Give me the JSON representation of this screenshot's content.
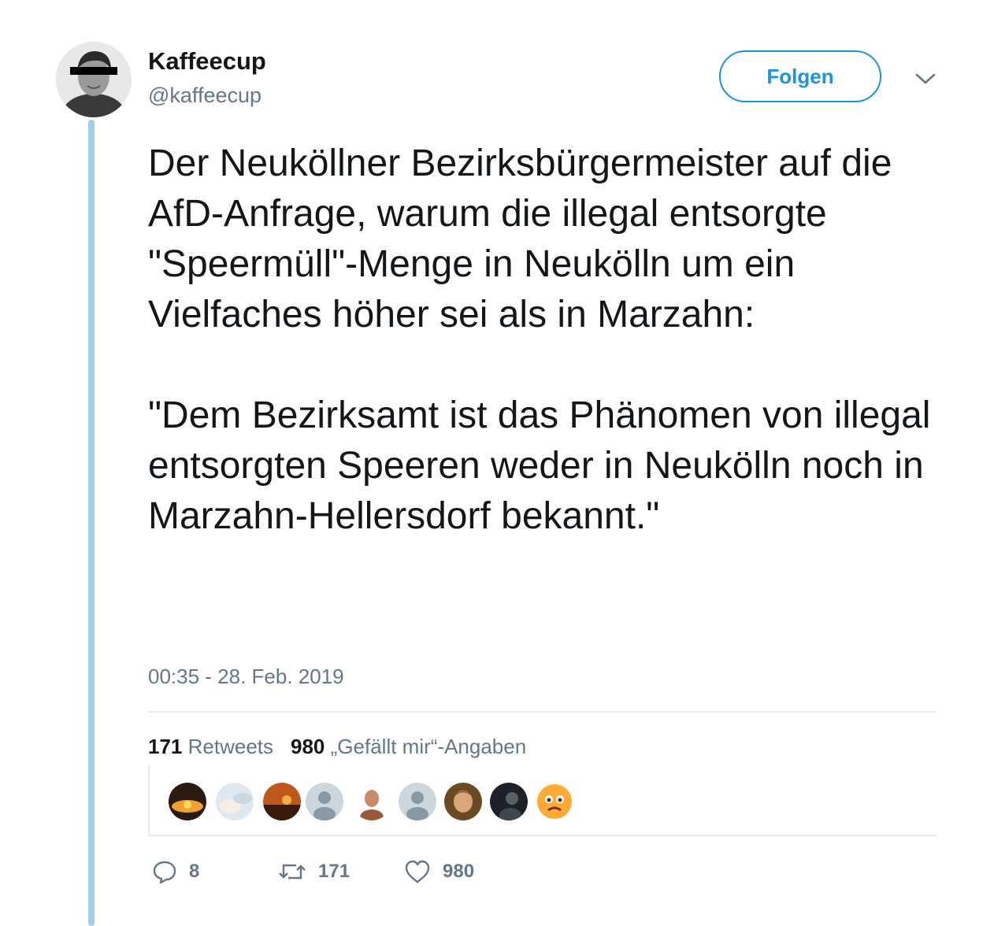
{
  "tweet": {
    "author": {
      "display_name": "Kaffeecup",
      "handle": "@kaffeecup"
    },
    "follow_label": "Folgen",
    "text": "Der Neuköllner Bezirksbürgermeister auf die AfD-Anfrage, warum die illegal entsorgte \"Speermüll\"-Menge in Neukölln um ein Vielfaches höher sei als in Marzahn:\n\n\"Dem Bezirksamt ist das Phänomen von illegal entsorgten Speeren weder in Neukölln noch in Marzahn-Hellersdorf bekannt.\"",
    "timestamp": "00:35 - 28. Feb. 2019",
    "stats": {
      "retweets_count": "171",
      "retweets_label": "Retweets",
      "likes_count": "980",
      "likes_label": "„Gefällt mir“-Angaben"
    },
    "likers": [
      "sunset-avatar",
      "sky-avatar",
      "evening-avatar",
      "default-avatar",
      "face-avatar",
      "default-avatar",
      "portrait-avatar",
      "dark-avatar",
      "emoji-avatar"
    ],
    "actions": {
      "reply_count": "8",
      "retweet_count": "171",
      "like_count": "980"
    }
  },
  "colors": {
    "accent": "#1b95e0",
    "thread_line": "#9fd1e6",
    "muted": "#657786",
    "text": "#14171a"
  }
}
